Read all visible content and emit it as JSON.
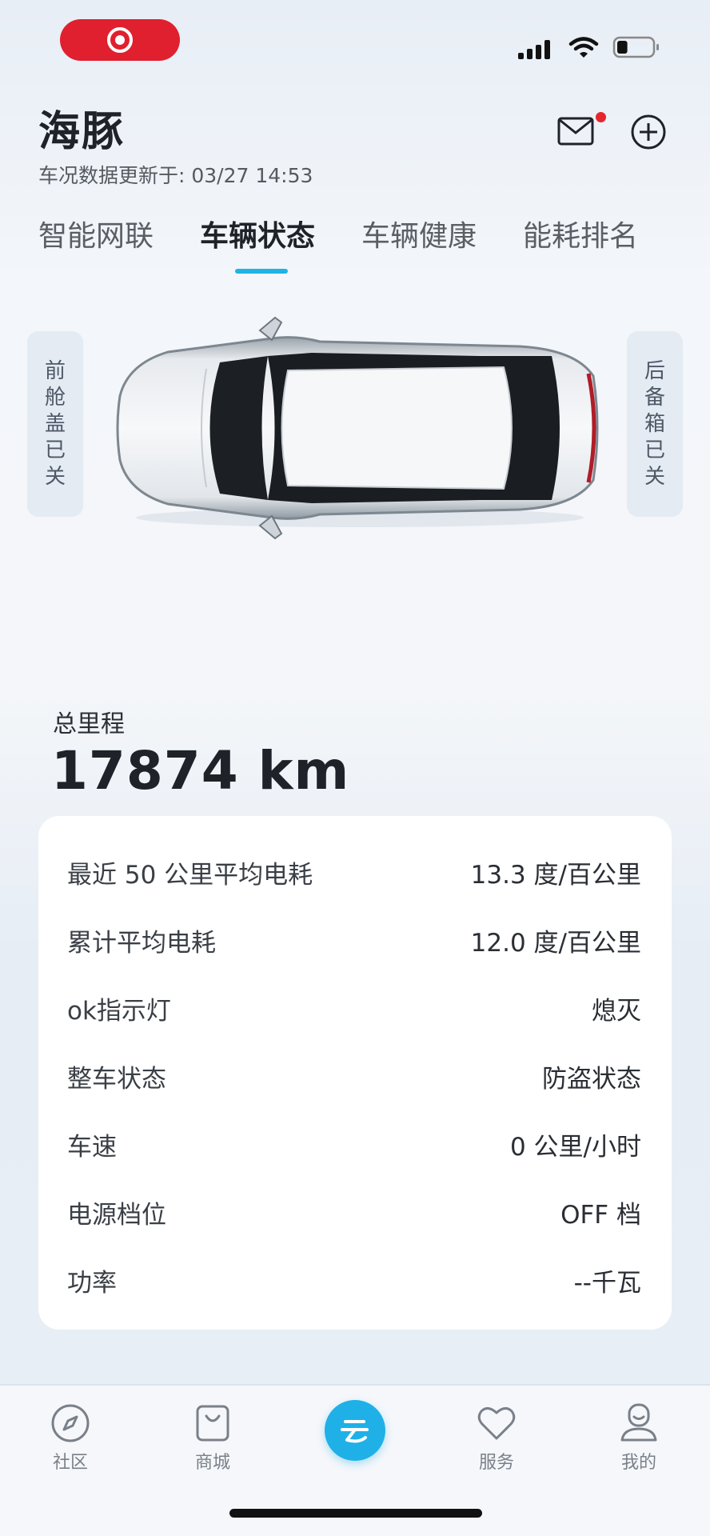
{
  "status_bar": {
    "battery_level": 0.3
  },
  "header": {
    "title": "海豚",
    "updated_text": "车况数据更新于: 03/27 14:53"
  },
  "tabs": [
    {
      "label": "智能网联",
      "active": false
    },
    {
      "label": "车辆状态",
      "active": true
    },
    {
      "label": "车辆健康",
      "active": false
    },
    {
      "label": "能耗排名",
      "active": false
    }
  ],
  "vehicle": {
    "front_hood": [
      "前",
      "舱",
      "盖",
      "已",
      "关"
    ],
    "trunk": [
      "后",
      "备",
      "箱",
      "已",
      "关"
    ]
  },
  "odometer": {
    "label": "总里程",
    "value": "17874 km"
  },
  "stats": [
    {
      "label": "最近 50 公里平均电耗",
      "value": "13.3 度/百公里"
    },
    {
      "label": "累计平均电耗",
      "value": "12.0 度/百公里"
    },
    {
      "label": "ok指示灯",
      "value": "熄灭"
    },
    {
      "label": "整车状态",
      "value": "防盗状态"
    },
    {
      "label": "车速",
      "value": "0 公里/小时"
    },
    {
      "label": "电源档位",
      "value": "OFF 档"
    },
    {
      "label": "功率",
      "value": "--千瓦"
    }
  ],
  "bottom_nav": [
    {
      "label": "社区",
      "icon": "compass-icon"
    },
    {
      "label": "商城",
      "icon": "bag-icon"
    },
    {
      "label": "",
      "icon": "cloud-logo-icon"
    },
    {
      "label": "服务",
      "icon": "heart-icon"
    },
    {
      "label": "我的",
      "icon": "profile-icon"
    }
  ],
  "colors": {
    "accent": "#1fb0e8",
    "badge": "#e5262e",
    "record": "#e0202e"
  }
}
